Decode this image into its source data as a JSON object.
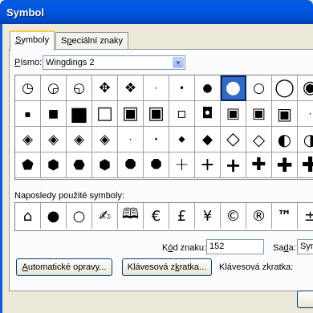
{
  "window": {
    "title": "Symbol"
  },
  "tabs": [
    {
      "label_u": "S",
      "label_rest": "ymboly"
    },
    {
      "label_pre": "S",
      "label_u": "p",
      "label_rest": "eciální znaky"
    }
  ],
  "font": {
    "label_u": "P",
    "label_rest": "ísmo:",
    "value": "Wingdings 2"
  },
  "symbols": [
    [
      "◷",
      "◶",
      "◵",
      "✥",
      "❖",
      "·",
      "•",
      "●",
      "●",
      "○",
      "◯",
      "◉"
    ],
    [
      "▪",
      "■",
      "■",
      "□",
      "▣",
      "▣",
      "▫",
      "◘",
      "▣",
      "·"
    ],
    [
      "◈",
      "◈",
      "◈",
      "◈",
      "·",
      "⬩",
      "⬥",
      "◆",
      "◇",
      "◐",
      "◑"
    ],
    [
      "⬟",
      "⬢",
      "⬣",
      "⬢",
      "⯃",
      "⯃",
      "+",
      "+",
      "+",
      "✚",
      "✚",
      "✚"
    ]
  ],
  "recent": {
    "label": "Naposledy použité symboly:",
    "items": [
      "⌂",
      "●",
      "○",
      "✍",
      "🕮",
      "€",
      "£",
      "¥",
      "©",
      "®",
      "™",
      "±"
    ]
  },
  "code": {
    "label_pre": "K",
    "label_u": "ó",
    "label_rest": "d znaku:",
    "value": "152"
  },
  "set": {
    "label_pre": "Sa",
    "label_u": "d",
    "label_rest": "a:",
    "value": "Sym"
  },
  "buttons": {
    "autocorrect_u": "A",
    "autocorrect_rest": "utomatické opravy...",
    "shortcut_pre": "Klávesová z",
    "shortcut_u": "k",
    "shortcut_rest": "ratka...",
    "shortcut_label": "Klávesová zkratka:"
  }
}
